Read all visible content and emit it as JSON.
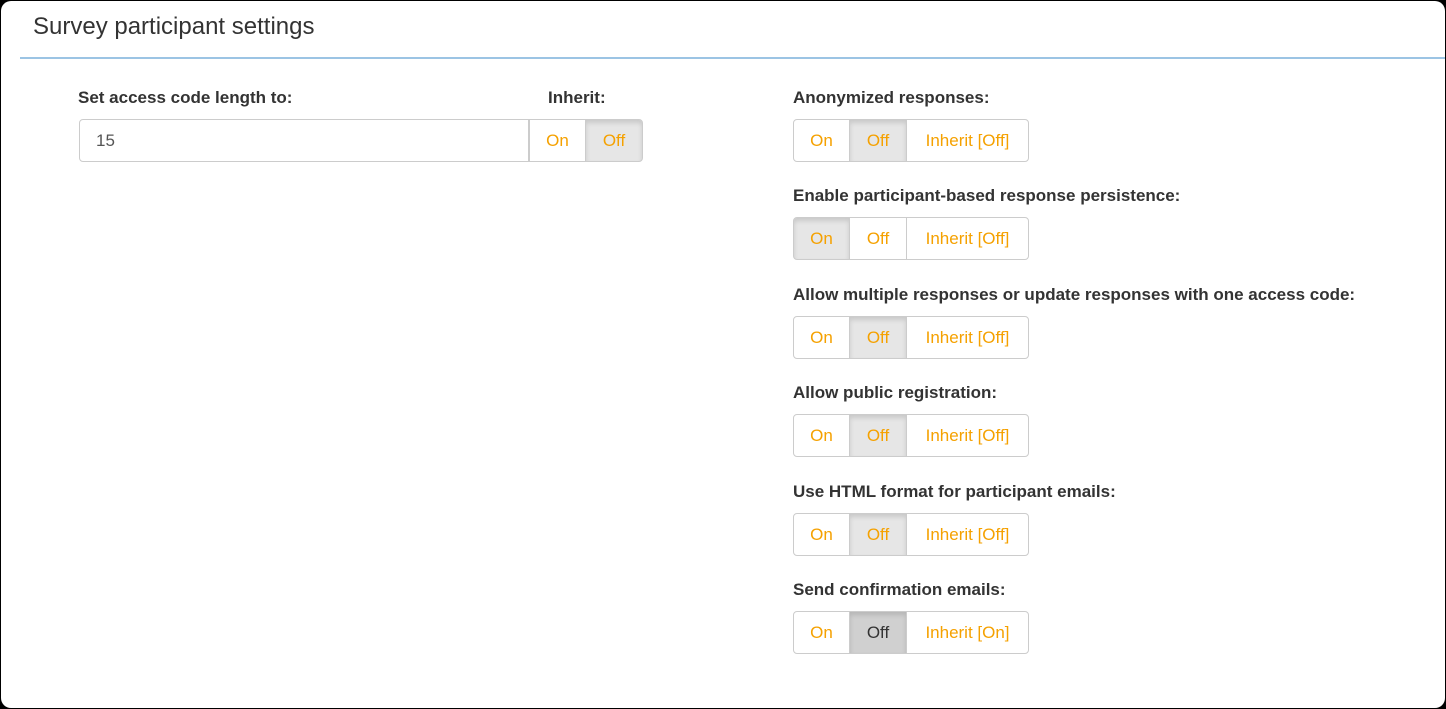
{
  "panel": {
    "title": "Survey participant settings"
  },
  "access_code": {
    "label": "Set access code length to:",
    "value": "15",
    "inherit_label": "Inherit:",
    "inherit_on": "On",
    "inherit_off": "Off",
    "inherit_selected": "Off"
  },
  "settings": [
    {
      "label": "Anonymized responses:",
      "on": "On",
      "off": "Off",
      "inherit": "Inherit [Off]",
      "selected": "Off"
    },
    {
      "label": "Enable participant-based response persistence:",
      "on": "On",
      "off": "Off",
      "inherit": "Inherit [Off]",
      "selected": "On"
    },
    {
      "label": "Allow multiple responses or update responses with one access code:",
      "on": "On",
      "off": "Off",
      "inherit": "Inherit [Off]",
      "selected": "Off"
    },
    {
      "label": "Allow public registration:",
      "on": "On",
      "off": "Off",
      "inherit": "Inherit [Off]",
      "selected": "Off"
    },
    {
      "label": "Use HTML format for participant emails:",
      "on": "On",
      "off": "Off",
      "inherit": "Inherit [Off]",
      "selected": "Off"
    },
    {
      "label": "Send confirmation emails:",
      "on": "On",
      "off": "Off",
      "inherit": "Inherit [On]",
      "selected": "Off"
    }
  ],
  "colors": {
    "accent": "#f5a100",
    "heading_border": "#9cc4e4",
    "active_bg": "#e6e6e6"
  }
}
